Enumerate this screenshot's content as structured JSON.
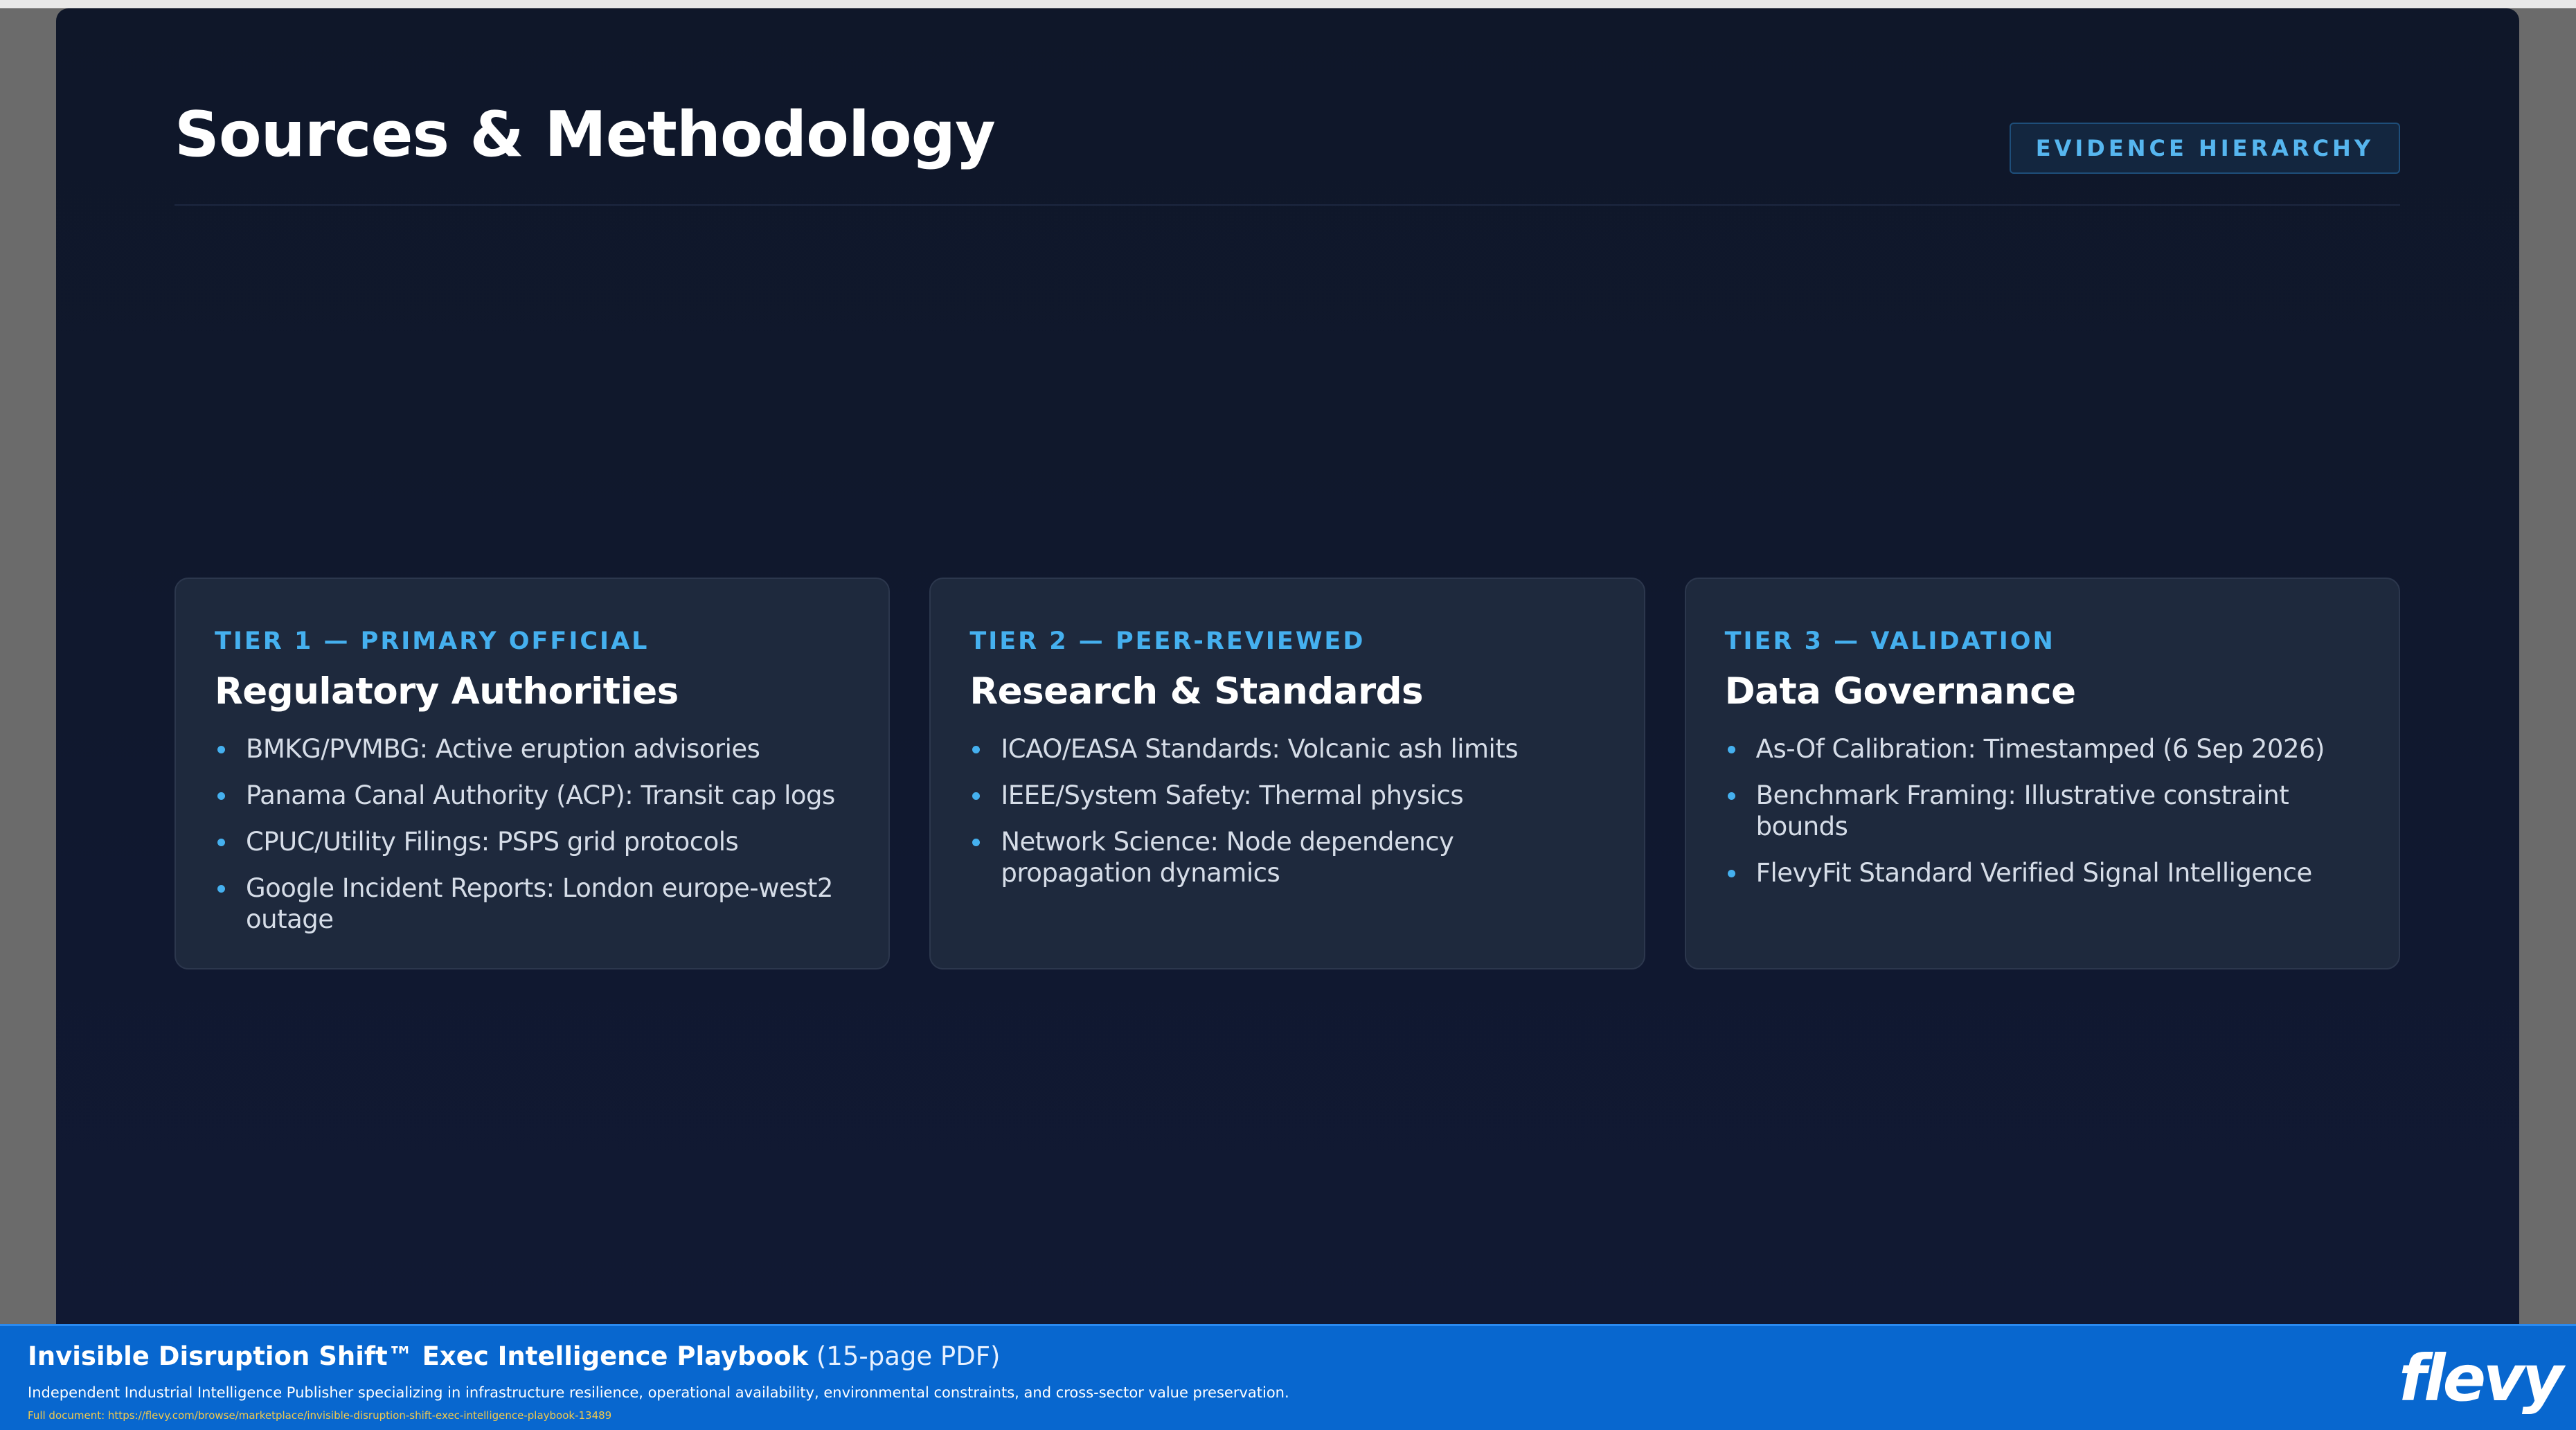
{
  "slide": {
    "title": "Sources & Methodology",
    "tag": "EVIDENCE HIERARCHY",
    "cards": [
      {
        "tier": "TIER 1 — PRIMARY OFFICIAL",
        "title": "Regulatory Authorities",
        "items": [
          "BMKG/PVMBG: Active eruption advisories",
          "Panama Canal Authority (ACP): Transit cap logs",
          "CPUC/Utility Filings: PSPS grid protocols",
          "Google Incident Reports: London europe-west2 outage"
        ]
      },
      {
        "tier": "TIER 2 — PEER-REVIEWED",
        "title": "Research & Standards",
        "items": [
          "ICAO/EASA Standards: Volcanic ash limits",
          "IEEE/System Safety: Thermal physics",
          "Network Science: Node dependency propagation dynamics"
        ]
      },
      {
        "tier": "TIER 3 — VALIDATION",
        "title": "Data Governance",
        "items": [
          "As-Of Calibration: Timestamped (6 Sep 2026)",
          "Benchmark Framing: Illustrative constraint bounds",
          "FlevyFit Standard Verified Signal Intelligence"
        ]
      }
    ]
  },
  "footer": {
    "title": "Invisible Disruption Shift™ Exec Intelligence Playbook",
    "title_suffix": "(15-page PDF)",
    "description": "Independent Industrial Intelligence Publisher specializing in infrastructure resilience, operational availability, environmental constraints, and cross-sector value preservation.",
    "url": "Full document: https://flevy.com/browse/marketplace/invisible-disruption-shift-exec-intelligence-playbook-13489",
    "logo": "flevy"
  },
  "colors": {
    "slide_background": "#0f1729",
    "card_background": "#1e293d",
    "accent": "#45b0ef",
    "footer_background": "#0867cf",
    "url_text": "#f2c94c"
  }
}
